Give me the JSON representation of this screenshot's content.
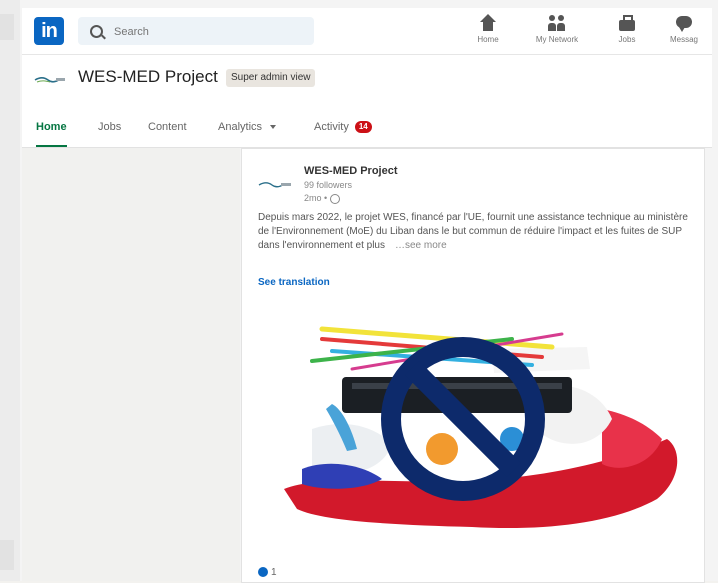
{
  "topnav": {
    "logo_text": "in",
    "search_placeholder": "Search",
    "items": [
      {
        "label": "Home",
        "icon": "home-icon"
      },
      {
        "label": "My Network",
        "icon": "network-icon"
      },
      {
        "label": "Jobs",
        "icon": "jobs-icon"
      },
      {
        "label": "Messag",
        "icon": "messaging-icon"
      }
    ]
  },
  "page": {
    "org_name": "WES-MED Project",
    "view_badge": "Super admin view",
    "tabs": [
      {
        "label": "Home",
        "active": true
      },
      {
        "label": "Jobs"
      },
      {
        "label": "Content"
      },
      {
        "label": "Analytics"
      },
      {
        "label": "Activity",
        "count": "14"
      }
    ]
  },
  "post": {
    "author": "WES-MED Project",
    "followers": "99 followers",
    "time": "2mo •",
    "text": "Depuis mars 2022, le projet WES, financé par l'UE, fournit une assistance technique au ministère de l'Environnement (MoE) du Liban dans le but commun de réduire l'impact et les fuites de SUP dans l'environnement et plus",
    "see_more": "…see more",
    "see_translation": "See translation",
    "reaction_count": "1"
  },
  "colors": {
    "brand_blue": "#0a66c2",
    "active_green": "#057642",
    "notification_red": "#cc1016",
    "no_symbol_navy": "#0d2a6b"
  }
}
